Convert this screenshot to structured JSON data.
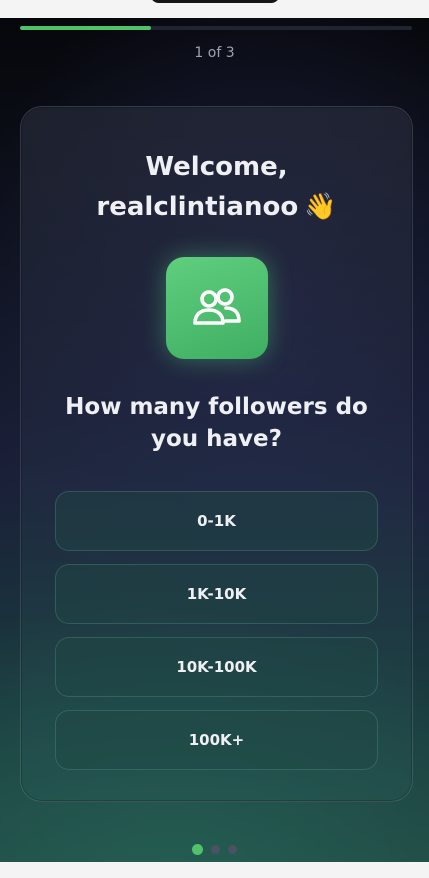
{
  "progress": {
    "label": "1 of 3",
    "fraction": 0.333,
    "color": "#4fc26a"
  },
  "welcome": {
    "line1": "Welcome,",
    "username": "realclintianoo",
    "wave": "👋"
  },
  "icon": {
    "name": "users-icon"
  },
  "question": "How many followers do you have?",
  "options": [
    {
      "label": "0-1K"
    },
    {
      "label": "1K-10K"
    },
    {
      "label": "10K-100K"
    },
    {
      "label": "100K+"
    }
  ],
  "pagination": {
    "total": 3,
    "active": 0
  },
  "colors": {
    "accent": "#4fc26a",
    "text": "#eef0f4",
    "muted": "#9ba3b3"
  }
}
